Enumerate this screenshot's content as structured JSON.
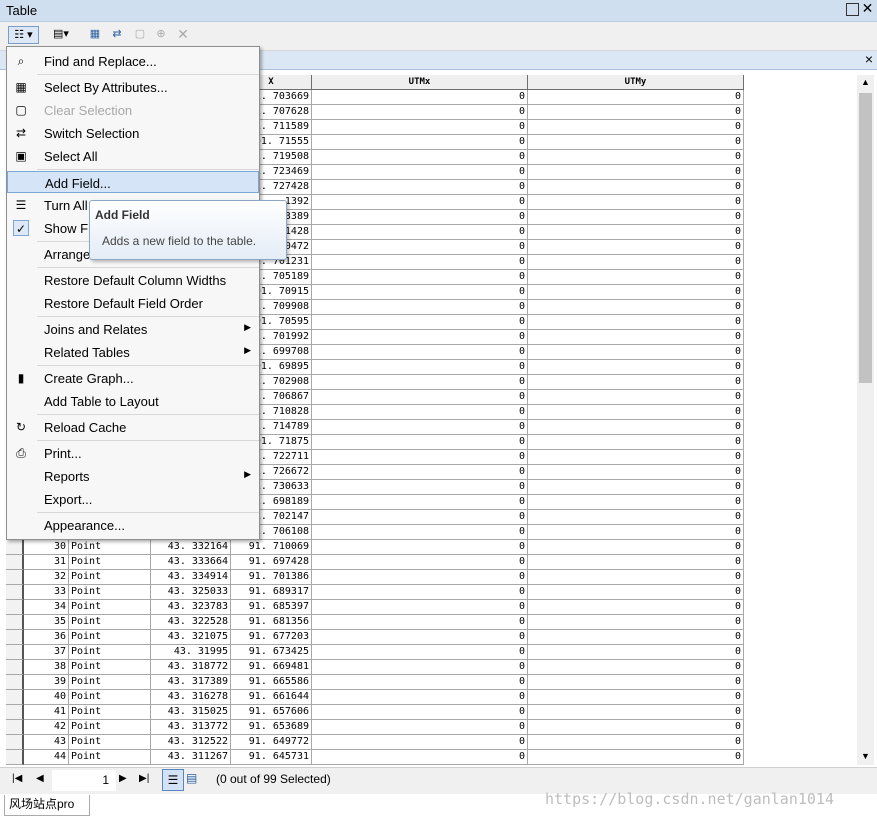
{
  "window": {
    "title": "Table",
    "tab_close": "×"
  },
  "table": {
    "columns": [
      "",
      "",
      "",
      "",
      "X",
      "UTMx",
      "UTMy"
    ],
    "rows": [
      {
        "fid": "",
        "shape": "",
        "lat": "",
        "x": "1. 703669",
        "utmx": "0",
        "utmy": "0"
      },
      {
        "fid": "",
        "shape": "",
        "lat": "",
        "x": "1. 707628",
        "utmx": "0",
        "utmy": "0"
      },
      {
        "fid": "",
        "shape": "",
        "lat": "",
        "x": "1. 711589",
        "utmx": "0",
        "utmy": "0"
      },
      {
        "fid": "",
        "shape": "",
        "lat": "",
        "x": "91. 71555",
        "utmx": "0",
        "utmy": "0"
      },
      {
        "fid": "",
        "shape": "",
        "lat": "",
        "x": "1. 719508",
        "utmx": "0",
        "utmy": "0"
      },
      {
        "fid": "",
        "shape": "",
        "lat": "",
        "x": "1. 723469",
        "utmx": "0",
        "utmy": "0"
      },
      {
        "fid": "",
        "shape": "",
        "lat": "",
        "x": "1. 727428",
        "utmx": "0",
        "utmy": "0"
      },
      {
        "fid": "",
        "shape": "",
        "lat": "",
        "x": "1392",
        "utmx": "0",
        "utmy": "0"
      },
      {
        "fid": "",
        "shape": "",
        "lat": "",
        "x": "3389",
        "utmx": "0",
        "utmy": "0"
      },
      {
        "fid": "",
        "shape": "",
        "lat": "",
        "x": "1428",
        "utmx": "0",
        "utmy": "0"
      },
      {
        "fid": "",
        "shape": "",
        "lat": "",
        "x": "0472",
        "utmx": "0",
        "utmy": "0"
      },
      {
        "fid": "",
        "shape": "",
        "lat": "",
        "x": "1. 701231",
        "utmx": "0",
        "utmy": "0"
      },
      {
        "fid": "",
        "shape": "",
        "lat": "",
        "x": "1. 705189",
        "utmx": "0",
        "utmy": "0"
      },
      {
        "fid": "",
        "shape": "",
        "lat": "",
        "x": "91. 70915",
        "utmx": "0",
        "utmy": "0"
      },
      {
        "fid": "",
        "shape": "",
        "lat": "",
        "x": "1. 709908",
        "utmx": "0",
        "utmy": "0"
      },
      {
        "fid": "",
        "shape": "",
        "lat": "",
        "x": "91. 70595",
        "utmx": "0",
        "utmy": "0"
      },
      {
        "fid": "",
        "shape": "",
        "lat": "",
        "x": "1. 701992",
        "utmx": "0",
        "utmy": "0"
      },
      {
        "fid": "",
        "shape": "",
        "lat": "",
        "x": "1. 699708",
        "utmx": "0",
        "utmy": "0"
      },
      {
        "fid": "",
        "shape": "",
        "lat": "",
        "x": "91. 69895",
        "utmx": "0",
        "utmy": "0"
      },
      {
        "fid": "",
        "shape": "",
        "lat": "",
        "x": "1. 702908",
        "utmx": "0",
        "utmy": "0"
      },
      {
        "fid": "",
        "shape": "",
        "lat": "",
        "x": "1. 706867",
        "utmx": "0",
        "utmy": "0"
      },
      {
        "fid": "",
        "shape": "",
        "lat": "",
        "x": "1. 710828",
        "utmx": "0",
        "utmy": "0"
      },
      {
        "fid": "",
        "shape": "",
        "lat": "",
        "x": "1. 714789",
        "utmx": "0",
        "utmy": "0"
      },
      {
        "fid": "",
        "shape": "",
        "lat": "",
        "x": "91. 71875",
        "utmx": "0",
        "utmy": "0"
      },
      {
        "fid": "",
        "shape": "",
        "lat": "",
        "x": "1. 722711",
        "utmx": "0",
        "utmy": "0"
      },
      {
        "fid": "",
        "shape": "",
        "lat": "",
        "x": "1. 726672",
        "utmx": "0",
        "utmy": "0"
      },
      {
        "fid": "",
        "shape": "",
        "lat": "",
        "x": "1. 730633",
        "utmx": "0",
        "utmy": "0"
      },
      {
        "fid": "",
        "shape": "",
        "lat": "",
        "x": "1. 698189",
        "utmx": "0",
        "utmy": "0"
      },
      {
        "fid": "",
        "shape": "",
        "lat": "",
        "x": "1. 702147",
        "utmx": "0",
        "utmy": "0"
      },
      {
        "fid": "",
        "shape": "",
        "lat": "",
        "x": "1. 706108",
        "utmx": "0",
        "utmy": "0"
      },
      {
        "fid": "30",
        "shape": "Point",
        "lat": "43. 332164",
        "x": "91. 710069",
        "utmx": "0",
        "utmy": "0"
      },
      {
        "fid": "31",
        "shape": "Point",
        "lat": "43. 333664",
        "x": "91. 697428",
        "utmx": "0",
        "utmy": "0"
      },
      {
        "fid": "32",
        "shape": "Point",
        "lat": "43. 334914",
        "x": "91. 701386",
        "utmx": "0",
        "utmy": "0"
      },
      {
        "fid": "33",
        "shape": "Point",
        "lat": "43. 325033",
        "x": "91. 689317",
        "utmx": "0",
        "utmy": "0"
      },
      {
        "fid": "34",
        "shape": "Point",
        "lat": "43. 323783",
        "x": "91. 685397",
        "utmx": "0",
        "utmy": "0"
      },
      {
        "fid": "35",
        "shape": "Point",
        "lat": "43. 322528",
        "x": "91. 681356",
        "utmx": "0",
        "utmy": "0"
      },
      {
        "fid": "36",
        "shape": "Point",
        "lat": "43. 321075",
        "x": "91. 677203",
        "utmx": "0",
        "utmy": "0"
      },
      {
        "fid": "37",
        "shape": "Point",
        "lat": "43. 31995",
        "x": "91. 673425",
        "utmx": "0",
        "utmy": "0"
      },
      {
        "fid": "38",
        "shape": "Point",
        "lat": "43. 318772",
        "x": "91. 669481",
        "utmx": "0",
        "utmy": "0"
      },
      {
        "fid": "39",
        "shape": "Point",
        "lat": "43. 317389",
        "x": "91. 665586",
        "utmx": "0",
        "utmy": "0"
      },
      {
        "fid": "40",
        "shape": "Point",
        "lat": "43. 316278",
        "x": "91. 661644",
        "utmx": "0",
        "utmy": "0"
      },
      {
        "fid": "41",
        "shape": "Point",
        "lat": "43. 315025",
        "x": "91. 657606",
        "utmx": "0",
        "utmy": "0"
      },
      {
        "fid": "42",
        "shape": "Point",
        "lat": "43. 313772",
        "x": "91. 653689",
        "utmx": "0",
        "utmy": "0"
      },
      {
        "fid": "43",
        "shape": "Point",
        "lat": "43. 312522",
        "x": "91. 649772",
        "utmx": "0",
        "utmy": "0"
      },
      {
        "fid": "44",
        "shape": "Point",
        "lat": "43. 311267",
        "x": "91. 645731",
        "utmx": "0",
        "utmy": "0"
      }
    ]
  },
  "menu": {
    "items": [
      {
        "label": "Find and Replace...",
        "icon": "binoculars-icon",
        "glyph": "⌕"
      },
      {
        "label": "Select By Attributes...",
        "icon": "select-by-attributes-icon",
        "glyph": "▦"
      },
      {
        "label": "Clear Selection",
        "icon": "clear-selection-icon",
        "glyph": "▢",
        "disabled": true
      },
      {
        "label": "Switch Selection",
        "icon": "switch-selection-icon",
        "glyph": "⇄"
      },
      {
        "label": "Select All",
        "icon": "select-all-icon",
        "glyph": "▣"
      },
      {
        "label": "Add Field...",
        "icon": "",
        "glyph": "",
        "highlighted": true
      },
      {
        "label": "Turn All",
        "icon": "turn-all-fields-icon",
        "glyph": "☰"
      },
      {
        "label": "Show Fi",
        "icon": "checkmark-icon",
        "glyph": "✓"
      },
      {
        "label": "Arrange",
        "icon": "",
        "glyph": ""
      },
      {
        "label": "Restore Default Column Widths",
        "icon": "",
        "glyph": ""
      },
      {
        "label": "Restore Default Field Order",
        "icon": "",
        "glyph": ""
      },
      {
        "label": "Joins and Relates",
        "icon": "",
        "glyph": "",
        "submenu": true
      },
      {
        "label": "Related Tables",
        "icon": "",
        "glyph": "",
        "submenu": true
      },
      {
        "label": "Create Graph...",
        "icon": "bar-graph-icon",
        "glyph": "▮"
      },
      {
        "label": "Add Table to Layout",
        "icon": "",
        "glyph": ""
      },
      {
        "label": "Reload Cache",
        "icon": "reload-icon",
        "glyph": "↻"
      },
      {
        "label": "Print...",
        "icon": "printer-icon",
        "glyph": "⎙"
      },
      {
        "label": "Reports",
        "icon": "",
        "glyph": "",
        "submenu": true
      },
      {
        "label": "Export...",
        "icon": "",
        "glyph": ""
      },
      {
        "label": "Appearance...",
        "icon": "",
        "glyph": ""
      }
    ],
    "submenu_arrow": "▶"
  },
  "tooltip": {
    "title": "Add Field",
    "text": "Adds a new field to the table."
  },
  "status": {
    "page": "1",
    "selection": "(0 out of 99 Selected)"
  },
  "bottom_tab": "风场站点pro",
  "watermark": "https://blog.csdn.net/ganlan1014"
}
